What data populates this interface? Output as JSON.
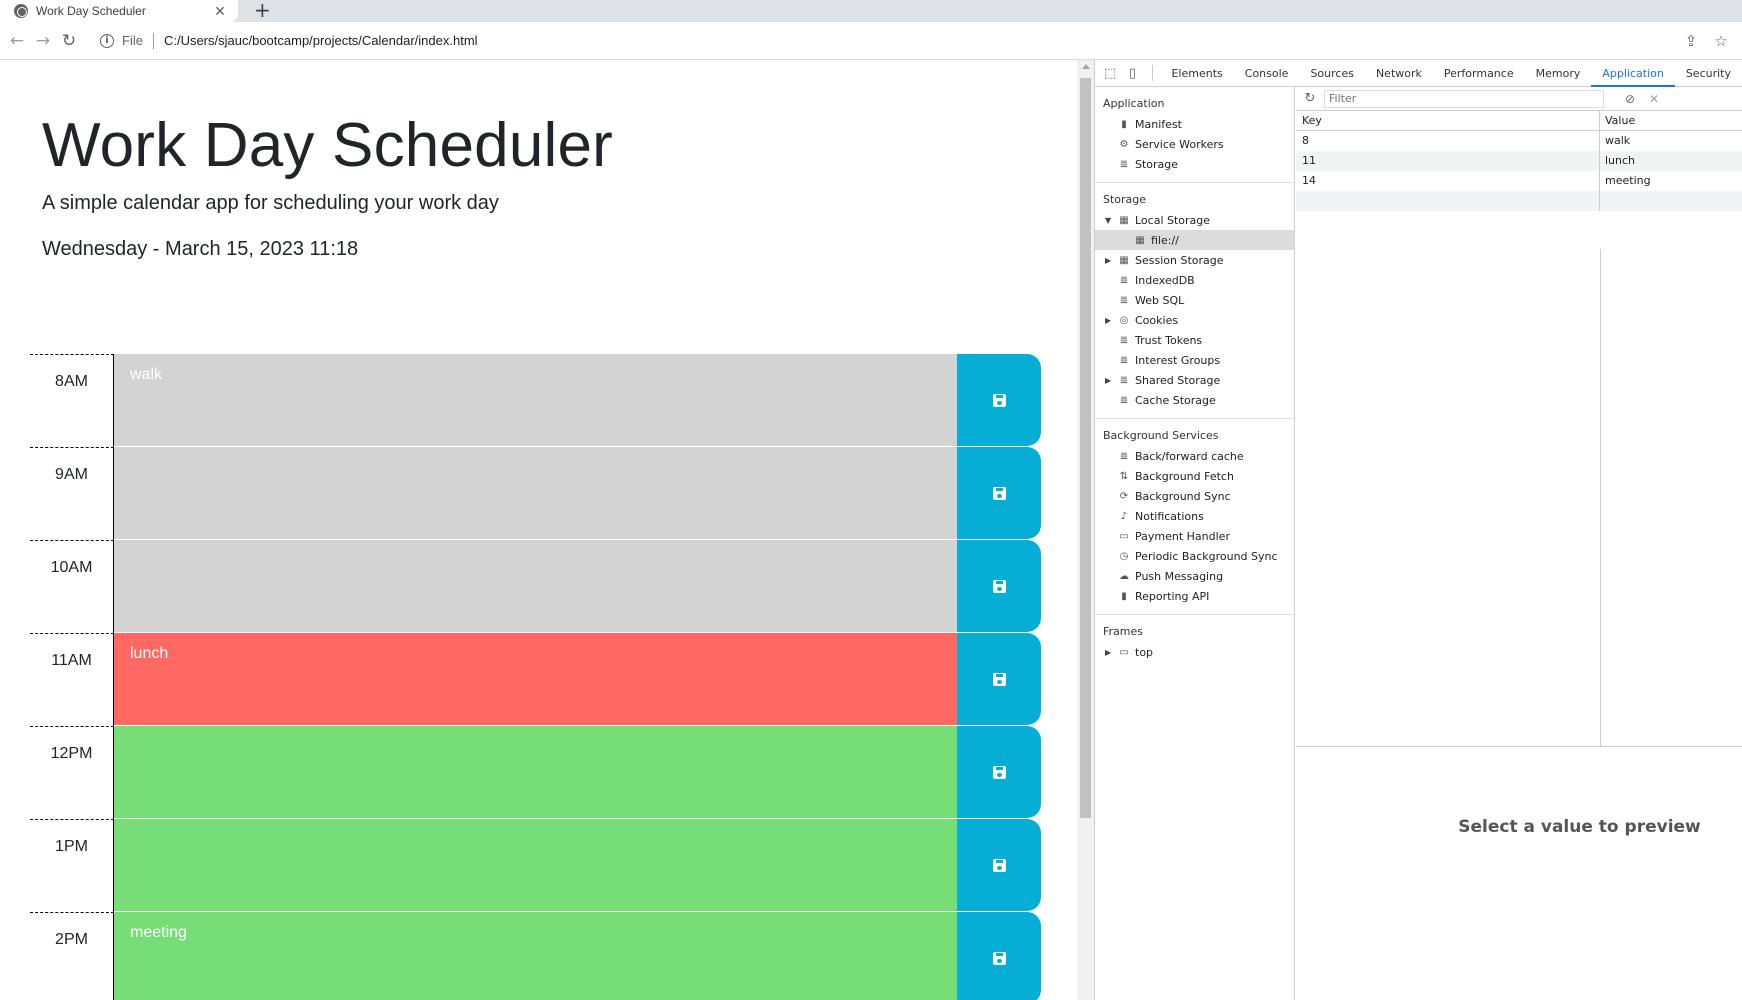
{
  "browser": {
    "tab_title": "Work Day Scheduler",
    "tab_close": "✕",
    "new_tab": "+",
    "file_label": "File",
    "url": "C:/Users/sjauc/bootcamp/projects/Calendar/index.html"
  },
  "page": {
    "title": "Work Day Scheduler",
    "lead": "A simple calendar app for scheduling your work day",
    "date": "Wednesday - March 15, 2023 11:18",
    "colors": {
      "past": "#d3d3d3",
      "present": "#ff6961",
      "future": "#77dd77",
      "save": "#06aed5"
    },
    "rows": [
      {
        "hour": "8AM",
        "text": "walk",
        "state": "past"
      },
      {
        "hour": "9AM",
        "text": "",
        "state": "past"
      },
      {
        "hour": "10AM",
        "text": "",
        "state": "past"
      },
      {
        "hour": "11AM",
        "text": "lunch",
        "state": "present"
      },
      {
        "hour": "12PM",
        "text": "",
        "state": "future"
      },
      {
        "hour": "1PM",
        "text": "",
        "state": "future"
      },
      {
        "hour": "2PM",
        "text": "meeting",
        "state": "future"
      }
    ]
  },
  "devtools": {
    "tabs": [
      "Elements",
      "Console",
      "Sources",
      "Network",
      "Performance",
      "Memory",
      "Application",
      "Security"
    ],
    "active_tab": "Application",
    "sidebar": {
      "application_heading": "Application",
      "application_items": [
        "Manifest",
        "Service Workers",
        "Storage"
      ],
      "storage_heading": "Storage",
      "local_storage": "Local Storage",
      "local_storage_child": "file://",
      "storage_items": [
        "Session Storage",
        "IndexedDB",
        "Web SQL",
        "Cookies",
        "Trust Tokens",
        "Interest Groups",
        "Shared Storage",
        "Cache Storage"
      ],
      "background_heading": "Background Services",
      "background_items": [
        "Back/forward cache",
        "Background Fetch",
        "Background Sync",
        "Notifications",
        "Payment Handler",
        "Periodic Background Sync",
        "Push Messaging",
        "Reporting API"
      ],
      "frames_heading": "Frames",
      "frames_item": "top"
    },
    "filter_placeholder": "Filter",
    "table": {
      "key_header": "Key",
      "value_header": "Value",
      "rows": [
        {
          "key": "8",
          "value": "walk"
        },
        {
          "key": "11",
          "value": "lunch"
        },
        {
          "key": "14",
          "value": "meeting"
        }
      ]
    },
    "preview_text": "Select a value to preview"
  }
}
